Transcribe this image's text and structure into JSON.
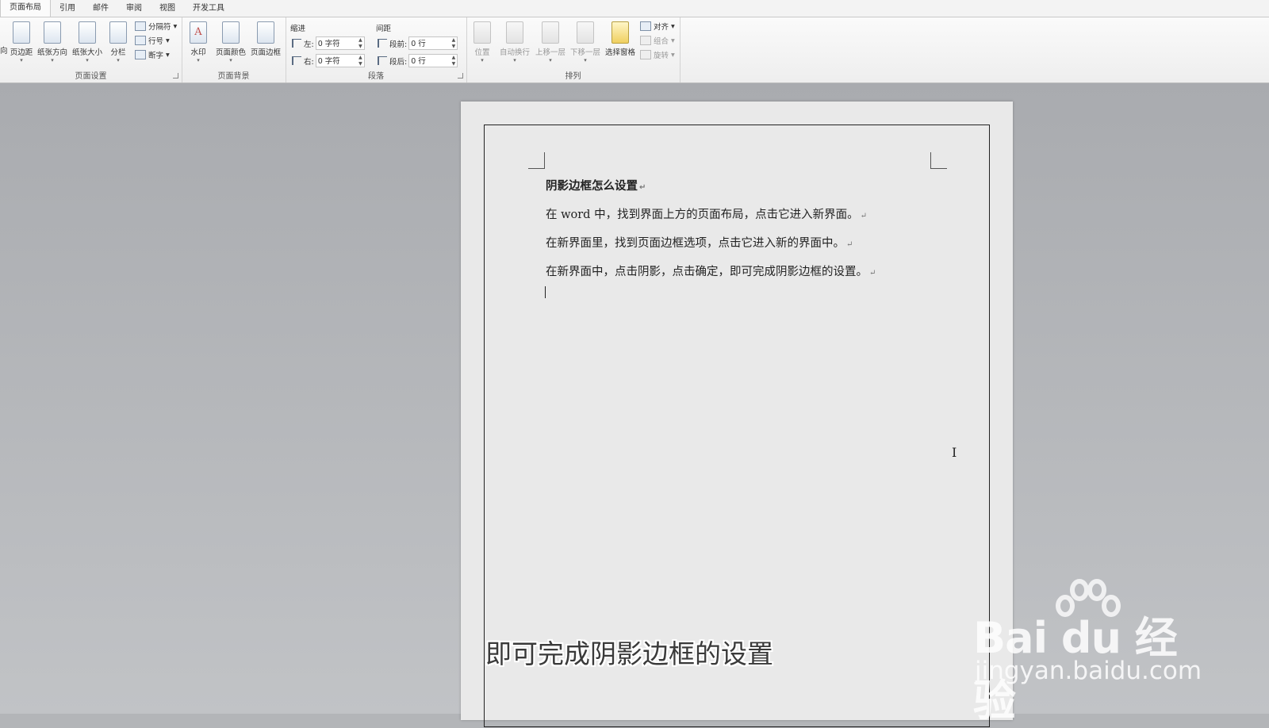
{
  "tabs": [
    "页面布局",
    "引用",
    "邮件",
    "审阅",
    "视图",
    "开发工具"
  ],
  "ribbon": {
    "page_setup": {
      "label": "页面设置",
      "partial": "向",
      "margins": "页边距",
      "orientation": "纸张方向",
      "size": "纸张大小",
      "columns": "分栏",
      "breaks": "分隔符",
      "line_numbers": "行号",
      "hyphenation": "断字"
    },
    "page_background": {
      "label": "页面背景",
      "watermark": "水印",
      "page_color": "页面颜色",
      "page_borders": "页面边框"
    },
    "paragraph": {
      "label": "段落",
      "indent_header": "缩进",
      "spacing_header": "间距",
      "left_label": "左:",
      "left_value": "0 字符",
      "right_label": "右:",
      "right_value": "0 字符",
      "before_label": "段前:",
      "before_value": "0 行",
      "after_label": "段后:",
      "after_value": "0 行"
    },
    "arrange": {
      "label": "排列",
      "position": "位置",
      "wrap_text": "自动换行",
      "bring_forward": "上移一层",
      "send_backward": "下移一层",
      "selection_pane": "选择窗格",
      "align": "对齐",
      "group": "组合",
      "rotate": "旋转"
    }
  },
  "document": {
    "title": "阴影边框怎么设置",
    "lines": [
      "在 word 中，找到界面上方的页面布局，点击它进入新界面。",
      "在新界面里，找到页面边框选项，点击它进入新的界面中。",
      "在新界面中，点击阴影，点击确定，即可完成阴影边框的设置。"
    ],
    "paragraph_mark": "↵"
  },
  "subtitle": "即可完成阴影边框的设置",
  "watermark": {
    "logo": "Bai du 经验",
    "url": "jingyan.baidu.com"
  }
}
